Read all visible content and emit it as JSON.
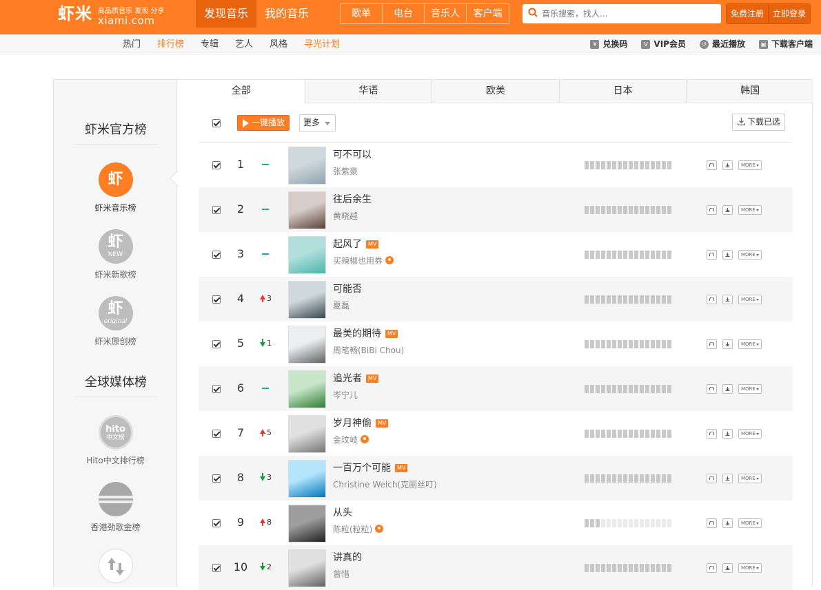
{
  "header": {
    "logo_cn": "虾米",
    "logo_slogan": "高品质音乐 发现 分享",
    "logo_domain": "xiami.com",
    "main_nav": [
      "发现音乐",
      "我的音乐"
    ],
    "sub_nav": [
      "歌单",
      "电台",
      "音乐人",
      "客户端"
    ],
    "search_placeholder": "音乐搜索，找人...",
    "register_label": "免费注册",
    "login_label": "立即登录"
  },
  "category_nav": {
    "items": [
      "热门",
      "排行榜",
      "专辑",
      "艺人",
      "风格",
      "寻光计划"
    ],
    "right_links": [
      {
        "icon": "yen-icon",
        "label": "兑换码"
      },
      {
        "icon": "vip-icon",
        "label": "VIP会员"
      },
      {
        "icon": "history-icon",
        "label": "最近播放"
      },
      {
        "icon": "client-icon",
        "label": "下载客户端"
      }
    ]
  },
  "sidebar": {
    "section1_title": "虾米官方榜",
    "section2_title": "全球媒体榜",
    "items": [
      {
        "label": "虾米音乐榜",
        "glyph": "虾",
        "sub": ""
      },
      {
        "label": "虾米新歌榜",
        "glyph": "虾",
        "sub": "NEW"
      },
      {
        "label": "虾米原创榜",
        "glyph": "虾",
        "sub": "original"
      },
      {
        "label": "Hito中文排行榜",
        "glyph": "hito",
        "sub": "中文榜"
      },
      {
        "label": "香港劲歌金榜",
        "glyph": "",
        "sub": ""
      }
    ]
  },
  "tabs": [
    "全部",
    "华语",
    "欧美",
    "日本",
    "韩国"
  ],
  "toolbar": {
    "play_all": "一键播放",
    "more": "更多",
    "download_selected": "下载已选"
  },
  "songs": [
    {
      "rank": "1",
      "trend": "flat",
      "change": "",
      "title": "可不可以",
      "mv": false,
      "artist": "张紫豪",
      "badge": false,
      "heat": 1.0
    },
    {
      "rank": "2",
      "trend": "flat",
      "change": "",
      "title": "往后余生",
      "mv": false,
      "artist": "黄晓越",
      "badge": false,
      "heat": 1.0
    },
    {
      "rank": "3",
      "trend": "flat",
      "change": "",
      "title": "起风了",
      "mv": true,
      "artist": "买辣椒也用券",
      "badge": true,
      "heat": 1.0
    },
    {
      "rank": "4",
      "trend": "up",
      "change": "3",
      "title": "可能否",
      "mv": false,
      "artist": "夏磊",
      "badge": false,
      "heat": 1.0
    },
    {
      "rank": "5",
      "trend": "down",
      "change": "1",
      "title": "最美的期待",
      "mv": true,
      "artist": "周笔畅(BiBi Chou)",
      "badge": false,
      "heat": 1.0
    },
    {
      "rank": "6",
      "trend": "flat",
      "change": "",
      "title": "追光者",
      "mv": true,
      "artist": "岑宁儿",
      "badge": false,
      "heat": 1.0
    },
    {
      "rank": "7",
      "trend": "up",
      "change": "5",
      "title": "岁月神偷",
      "mv": true,
      "artist": "金玟岐",
      "badge": true,
      "heat": 1.0
    },
    {
      "rank": "8",
      "trend": "down",
      "change": "3",
      "title": "一百万个可能",
      "mv": true,
      "artist": "Christine Welch(克丽丝叮)",
      "badge": false,
      "heat": 1.0
    },
    {
      "rank": "9",
      "trend": "up",
      "change": "8",
      "title": "从头",
      "mv": false,
      "artist": "陈粒(粒粒)",
      "badge": true,
      "heat": 0.2
    },
    {
      "rank": "10",
      "trend": "down",
      "change": "2",
      "title": "讲真的",
      "mv": false,
      "artist": "曾惜",
      "badge": false,
      "heat": 1.0
    }
  ],
  "row_ops": {
    "more_label": "MORE"
  },
  "colors": {
    "brand": "#ff7e23",
    "up": "#e8372d",
    "down": "#1c9b3c",
    "flat": "#1ba8a0"
  }
}
